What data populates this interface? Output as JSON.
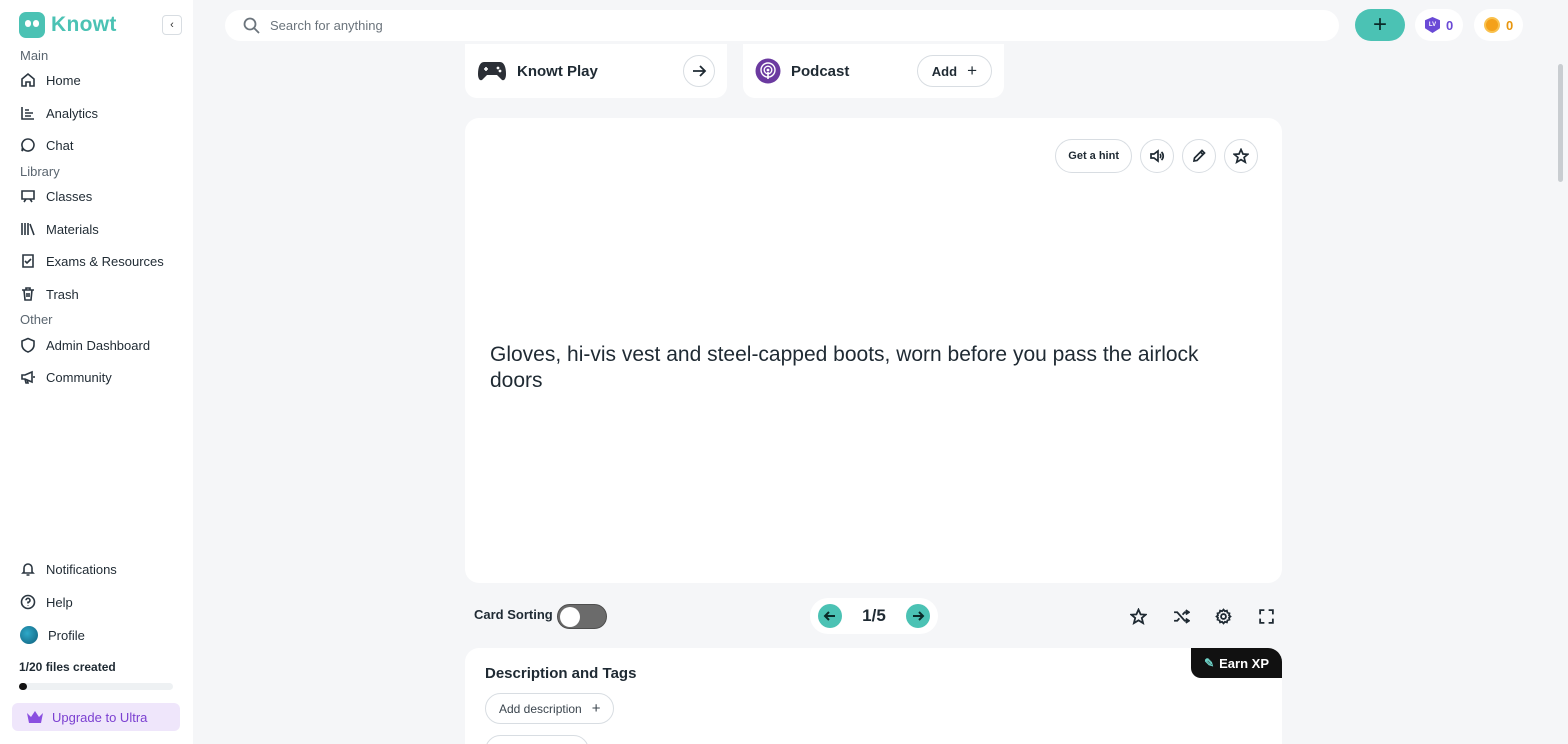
{
  "app": {
    "name": "Knowt"
  },
  "sidebar": {
    "sections": {
      "main": "Main",
      "library": "Library",
      "other": "Other"
    },
    "main_items": [
      {
        "label": "Home",
        "icon": "home-icon"
      },
      {
        "label": "Analytics",
        "icon": "analytics-icon"
      },
      {
        "label": "Chat",
        "icon": "chat-icon"
      }
    ],
    "library_items": [
      {
        "label": "Classes",
        "icon": "classes-icon"
      },
      {
        "label": "Materials",
        "icon": "materials-icon"
      },
      {
        "label": "Exams & Resources",
        "icon": "exams-icon"
      },
      {
        "label": "Trash",
        "icon": "trash-icon"
      }
    ],
    "other_items": [
      {
        "label": "Admin Dashboard",
        "icon": "shield-icon"
      },
      {
        "label": "Community",
        "icon": "megaphone-icon"
      }
    ],
    "bottom_items": [
      {
        "label": "Notifications",
        "icon": "bell-icon"
      },
      {
        "label": "Help",
        "icon": "help-icon"
      },
      {
        "label": "Profile",
        "icon": "avatar"
      }
    ],
    "files_created": "1/20 files created",
    "files_progress": 0.05,
    "upgrade_label": "Upgrade to Ultra"
  },
  "topbar": {
    "search_placeholder": "Search for anything",
    "level_count": "0",
    "coin_count": "0"
  },
  "features": {
    "play_title": "Knowt Play",
    "podcast_title": "Podcast",
    "podcast_add": "Add"
  },
  "flashcard": {
    "hint_label": "Get a hint",
    "text": "Gloves, hi-vis vest and steel-capped boots, worn before you pass the airlock doors"
  },
  "controls": {
    "card_sorting_label": "Card Sorting",
    "card_sorting_on": false,
    "page_indicator": "1/5"
  },
  "description": {
    "title": "Description and Tags",
    "earn_xp_label": "Earn XP",
    "add_description_label": "Add description"
  },
  "colors": {
    "accent": "#4bc2b4",
    "brand_purple": "#8a4fe0",
    "coin": "#f4a11a",
    "background": "#f5f6f8"
  }
}
